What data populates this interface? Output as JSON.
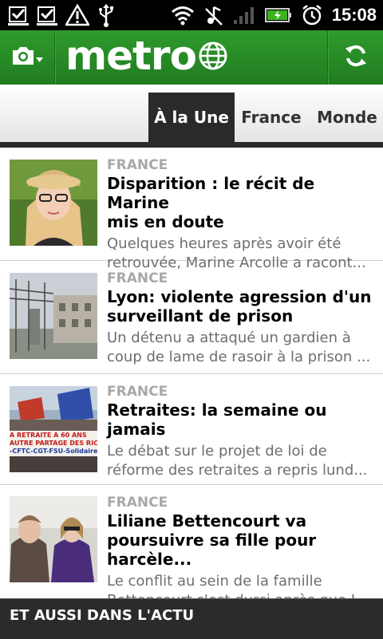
{
  "status_bar": {
    "time": "15:08",
    "icons": [
      "download-done-icon",
      "download-done-icon",
      "warning-icon",
      "usb-icon",
      "wifi-icon",
      "music-off-icon",
      "signal-icon",
      "battery-charging-icon",
      "alarm-icon"
    ]
  },
  "app_bar": {
    "logo": "metro",
    "camera_icon": "camera-icon",
    "refresh_icon": "refresh-icon",
    "brand_color": "#2e8a2a"
  },
  "tabs": [
    {
      "label": "À la Une",
      "active": true
    },
    {
      "label": "France",
      "active": false
    },
    {
      "label": "Monde",
      "active": false
    }
  ],
  "articles": [
    {
      "category": "FRANCE",
      "title_lines": [
        "Disparition : le récit de Marine",
        "mis en doute"
      ],
      "summary_lines": [
        "Quelques heures après avoir été",
        "retrouvée, Marine Arcolle a racont..."
      ]
    },
    {
      "category": "FRANCE",
      "title_lines": [
        "Lyon: violente agression d'un",
        "surveillant de prison"
      ],
      "summary_lines": [
        "Un détenu a attaqué un gardien à",
        "coup de lame de rasoir à la prison ..."
      ]
    },
    {
      "category": "FRANCE",
      "title_lines": [
        "Retraites: la semaine ou jamais"
      ],
      "summary_lines": [
        "Le débat sur le projet de loi de",
        "réforme des retraites a repris lund..."
      ],
      "thumb_text": [
        "A RETRAITE À 60 ANS",
        "AUTRE PARTAGE DES RICHE",
        "-CFTC-CGT-FSU-Solidaires-U"
      ]
    },
    {
      "category": "FRANCE",
      "title_lines": [
        "Liliane Bettencourt va",
        "poursuivre sa fille pour harcèle..."
      ],
      "summary_lines": [
        "Le conflit au sein de la famille",
        "Bettencourt s'est durci après que L..."
      ]
    }
  ],
  "section": {
    "label": "ET AUSSI DANS L'ACTU"
  }
}
